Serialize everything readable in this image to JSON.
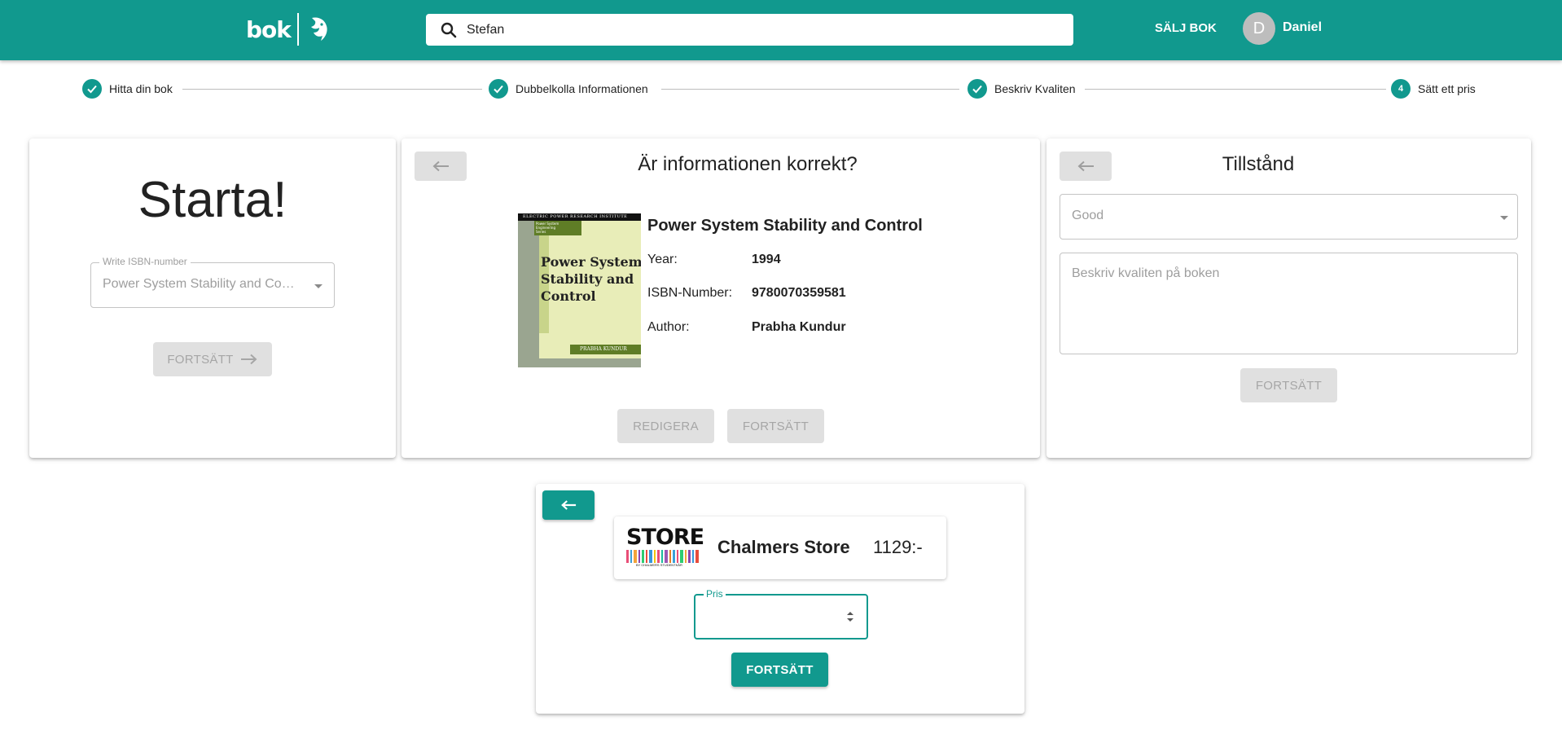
{
  "header": {
    "logo_text": "bok",
    "search_value": "Stefan",
    "sell_label": "SÄLJ BOK",
    "avatar_initial": "D",
    "user_name": "Daniel",
    "brand_color": "#11998e"
  },
  "stepper": {
    "steps": [
      {
        "label": "Hitta din bok",
        "state": "done"
      },
      {
        "label": "Dubbelkolla Informationen",
        "state": "done"
      },
      {
        "label": "Beskriv Kvaliten",
        "state": "done"
      },
      {
        "label": "Sätt ett pris",
        "state": "active",
        "number": "4"
      }
    ]
  },
  "start_card": {
    "title": "Starta!",
    "isbn_label": "Write ISBN-number",
    "isbn_value": "Power System Stability and Control",
    "continue_label": "FORTSÄTT"
  },
  "info_card": {
    "title": "Är informationen korrekt?",
    "book_title": "Power System Stability and Control",
    "year_label": "Year:",
    "year_value": "1994",
    "isbn_label": "ISBN-Number:",
    "isbn_value": "9780070359581",
    "author_label": "Author:",
    "author_value": "Prabha Kundur",
    "cover": {
      "top_text": "ELECTRIC POWER RESEARCH INSTITUTE",
      "series_text": "Power System Engineering Series",
      "title_line1": "Power System",
      "title_line2": "Stability and",
      "title_line3": "Control",
      "author": "PRABHA KUNDUR"
    },
    "edit_label": "REDIGERA",
    "continue_label": "FORTSÄTT"
  },
  "condition_card": {
    "title": "Tillstånd",
    "condition_value": "Good",
    "description_placeholder": "Beskriv kvaliten på boken",
    "continue_label": "FORTSÄTT"
  },
  "price_card": {
    "store_logo_text": "STORE",
    "store_logo_sub": "BY CHALMERS STUDENTKÅR",
    "store_name": "Chalmers Store",
    "store_price": "1129:-",
    "price_label": "Pris",
    "price_value": "",
    "continue_label": "FORTSÄTT"
  }
}
